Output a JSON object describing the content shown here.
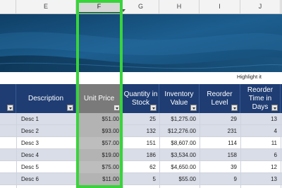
{
  "columns": [
    "E",
    "F",
    "G",
    "H",
    "I",
    "J"
  ],
  "selected_column": "F",
  "note": "Highlight it",
  "headers": {
    "description": "Description",
    "unit_price": "Unit Price",
    "quantity": "Quantity in Stock",
    "inventory_value": "Inventory Value",
    "reorder_level": "Reorder Level",
    "reorder_time": "Reorder Time in Days"
  },
  "rows": [
    {
      "desc": "Desc 1",
      "price": "$51.00",
      "qty": "25",
      "value": "$1,275.00",
      "level": "29",
      "days": "13"
    },
    {
      "desc": "Desc 2",
      "price": "$93.00",
      "qty": "132",
      "value": "$12,276.00",
      "level": "231",
      "days": "4"
    },
    {
      "desc": "Desc 3",
      "price": "$57.00",
      "qty": "151",
      "value": "$8,607.00",
      "level": "114",
      "days": "11"
    },
    {
      "desc": "Desc 4",
      "price": "$19.00",
      "qty": "186",
      "value": "$3,534.00",
      "level": "158",
      "days": "6"
    },
    {
      "desc": "Desc 5",
      "price": "$75.00",
      "qty": "62",
      "value": "$4,650.00",
      "level": "39",
      "days": "12"
    },
    {
      "desc": "Desc 6",
      "price": "$11.00",
      "qty": "5",
      "value": "$55.00",
      "level": "9",
      "days": "13"
    }
  ],
  "colors": {
    "header_bg": "#1f3d73",
    "highlight": "#38d43a",
    "selected_col": "#b3b3b3"
  }
}
